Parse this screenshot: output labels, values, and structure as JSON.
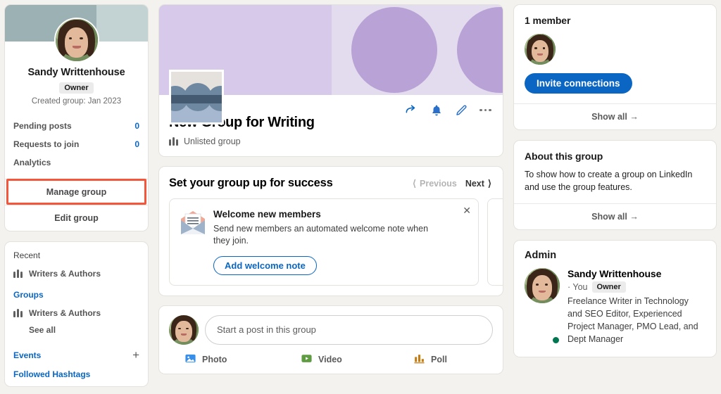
{
  "colors": {
    "linkedin_blue": "#0a66c2",
    "page_bg": "#f4f2ee",
    "highlight_red": "#f4563c",
    "banner_lavender": "#d6c9e9",
    "banner_lavender_light": "#e3dbee",
    "banner_circle": "#b8a2d6",
    "profile_banner": "#9cb1b3",
    "online_green": "#01754f"
  },
  "left_sidebar": {
    "profile": {
      "name": "Sandy Writtenhouse",
      "role_badge": "Owner",
      "created": "Created group: Jan 2023"
    },
    "stats": [
      {
        "label": "Pending posts",
        "value": "0"
      },
      {
        "label": "Requests to join",
        "value": "0"
      },
      {
        "label": "Analytics",
        "value": ""
      }
    ],
    "manage_group_label": "Manage group",
    "edit_group_label": "Edit group",
    "nav": {
      "recent_header": "Recent",
      "recent_items": [
        {
          "label": "Writers & Authors"
        }
      ],
      "groups_header": "Groups",
      "groups_items": [
        {
          "label": "Writers & Authors"
        }
      ],
      "see_all_label": "See all",
      "events_label": "Events",
      "followed_hashtags_label": "Followed Hashtags"
    }
  },
  "group": {
    "title": "New Group for Writing",
    "visibility": "Unlisted group",
    "actions": [
      {
        "name": "share-icon"
      },
      {
        "name": "bell-icon"
      },
      {
        "name": "edit-pencil-icon"
      },
      {
        "name": "more-options-icon"
      }
    ]
  },
  "success_section": {
    "title": "Set your group up for success",
    "previous_label": "Previous",
    "next_label": "Next",
    "tips": [
      {
        "title": "Welcome new members",
        "description": "Send new members an automated welcome note when they join.",
        "button_label": "Add welcome note",
        "icon": "envelope-icon"
      }
    ]
  },
  "composer": {
    "placeholder": "Start a post in this group",
    "options": [
      {
        "label": "Photo",
        "icon": "photo-icon",
        "color": "#378fe9"
      },
      {
        "label": "Video",
        "icon": "video-icon",
        "color": "#5f9b41"
      },
      {
        "label": "Poll",
        "icon": "poll-icon",
        "color": "#c37d16"
      }
    ]
  },
  "right_sidebar": {
    "members_card": {
      "title": "1 member",
      "invite_label": "Invite connections",
      "show_all_label": "Show all"
    },
    "about_card": {
      "title": "About this group",
      "body": "To show how to create a group on LinkedIn and use the group features.",
      "show_all_label": "Show all"
    },
    "admin_card": {
      "title": "Admin",
      "name": "Sandy Writtenhouse",
      "you_label": "· You",
      "role_badge": "Owner",
      "headline": "Freelance Writer in Technology and SEO Editor, Experienced Project Manager, PMO Lead, and Dept Manager"
    }
  }
}
